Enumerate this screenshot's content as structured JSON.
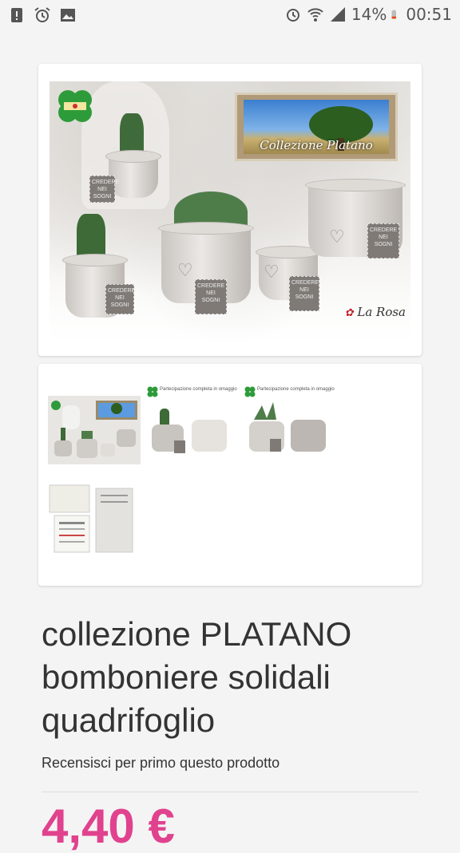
{
  "status_bar": {
    "battery_percent": "14%",
    "time": "00:51",
    "icons": [
      "alert-icon",
      "alarm-clock-icon",
      "image-icon",
      "alarm-icon",
      "wifi-icon",
      "signal-icon",
      "battery-icon"
    ]
  },
  "product_image": {
    "frame_caption": "Collezione Platano",
    "tag_text": "CREDERE NEI SOGNI",
    "brand": "La Rosa"
  },
  "gallery": {
    "thumb_heading": "Partecipazione completa in omaggio"
  },
  "product": {
    "title": "collezione PLATANO bomboniere solidali quadrifoglio",
    "review_link": "Recensisci per primo questo prodotto",
    "price_partial": "4,40 €"
  },
  "colors": {
    "price": "#e0428e",
    "background": "#f4f4f4"
  }
}
